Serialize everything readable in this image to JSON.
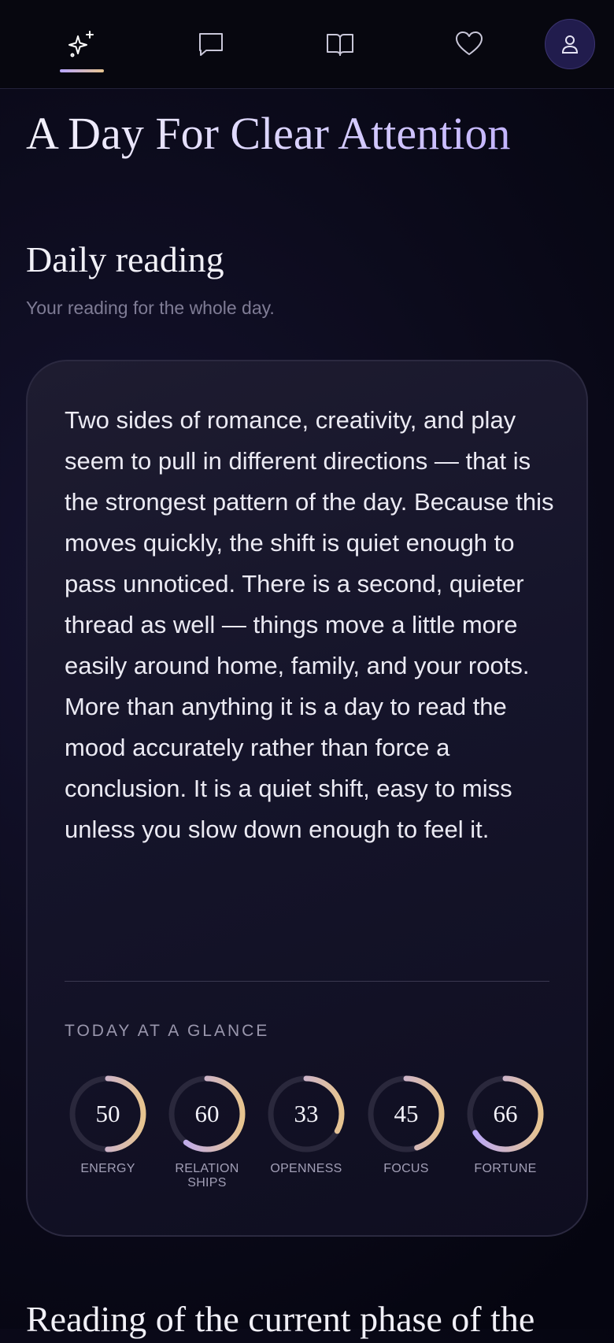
{
  "nav": {
    "items": [
      {
        "icon": "sparkles-icon",
        "active": true
      },
      {
        "icon": "chat-icon",
        "active": false
      },
      {
        "icon": "book-icon",
        "active": false
      },
      {
        "icon": "heart-icon",
        "active": false
      }
    ],
    "profile_icon": "user-icon"
  },
  "hero": {
    "title": "A Day For Clear Attention"
  },
  "daily": {
    "title": "Daily reading",
    "subtitle": "Your reading for the whole day.",
    "body": "Two sides of romance, creativity, and play seem to pull in different directions — that is the strongest pattern of the day. Because this moves quickly, the shift is quiet enough to pass unnoticed. There is a second, quieter thread as well — things move a little more easily around home, family, and your roots. More than anything it is a day to read the mood accurately rather than force a conclusion. It is a quiet shift, easy to miss unless you slow down enough to feel it.",
    "glance_label": "TODAY AT A GLANCE",
    "meters": [
      {
        "label": "ENERGY",
        "value": "50",
        "fill": 0.5
      },
      {
        "label": "RELATION\nSHIPS",
        "value": "60",
        "fill": 0.6
      },
      {
        "label": "OPENNESS",
        "value": "33",
        "fill": 0.33
      },
      {
        "label": "FOCUS",
        "value": "45",
        "fill": 0.45
      },
      {
        "label": "FORTUNE",
        "value": "66",
        "fill": 0.66
      }
    ]
  },
  "next_section": {
    "title": "Reading of the current phase of the"
  },
  "colors": {
    "accent_violet": "#b7a6ff",
    "accent_gold": "#e7c48f",
    "track": "#2a283c"
  }
}
